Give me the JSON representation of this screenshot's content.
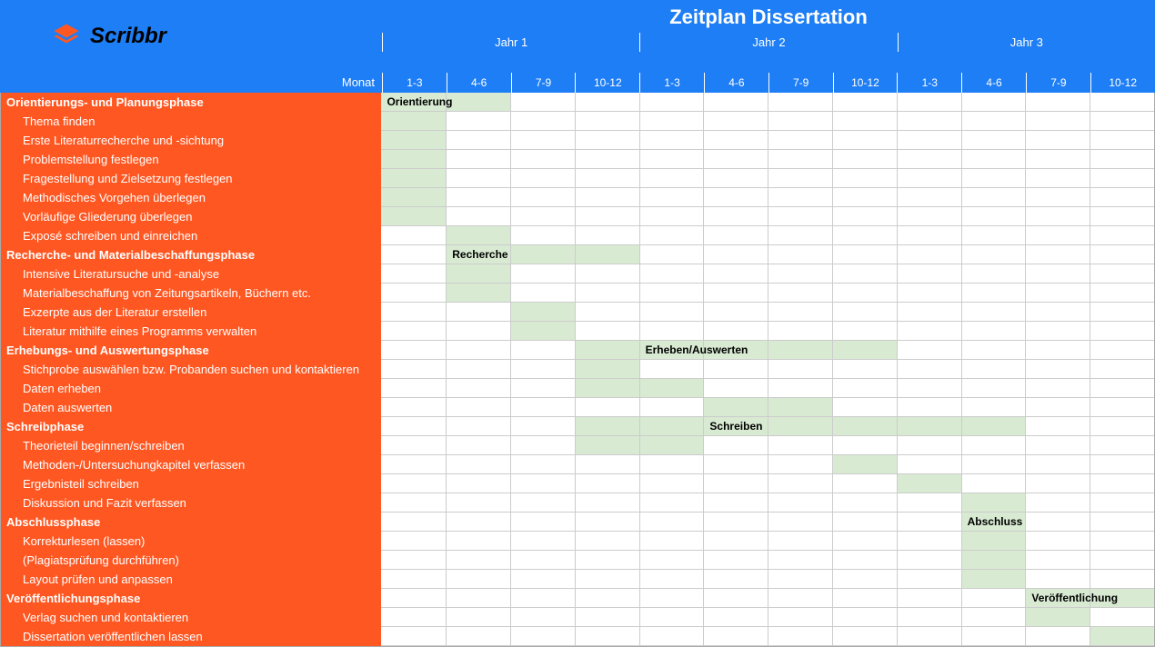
{
  "brand": "Scribbr",
  "title": "Zeitplan Dissertation",
  "month_label": "Monat",
  "years": [
    "Jahr 1",
    "Jahr 2",
    "Jahr 3"
  ],
  "months": [
    "1-3",
    "4-6",
    "7-9",
    "10-12",
    "1-3",
    "4-6",
    "7-9",
    "10-12",
    "1-3",
    "4-6",
    "7-9",
    "10-12"
  ],
  "phases": [
    {
      "name": "Orientierungs- und Planungsphase",
      "bar_label": "Orientierung",
      "label_col": 0,
      "cells": [
        0,
        1
      ],
      "tasks": [
        {
          "name": "Thema finden",
          "cells": [
            0
          ]
        },
        {
          "name": "Erste Literaturrecherche und -sichtung",
          "cells": [
            0
          ]
        },
        {
          "name": "Problemstellung festlegen",
          "cells": [
            0
          ]
        },
        {
          "name": "Fragestellung und Zielsetzung festlegen",
          "cells": [
            0
          ]
        },
        {
          "name": "Methodisches Vorgehen überlegen",
          "cells": [
            0
          ]
        },
        {
          "name": "Vorläufige Gliederung überlegen",
          "cells": [
            0
          ]
        },
        {
          "name": "Exposé schreiben und einreichen",
          "cells": [
            1
          ]
        }
      ]
    },
    {
      "name": "Recherche- und Materialbeschaffungsphase",
      "bar_label": "Recherche",
      "label_col": 1,
      "cells": [
        1,
        2,
        3
      ],
      "tasks": [
        {
          "name": "Intensive Literatursuche und -analyse",
          "cells": [
            1
          ]
        },
        {
          "name": "Materialbeschaffung von Zeitungsartikeln, Büchern etc.",
          "cells": [
            1
          ]
        },
        {
          "name": "Exzerpte aus der Literatur erstellen",
          "cells": [
            2
          ]
        },
        {
          "name": "Literatur mithilfe eines Programms verwalten",
          "cells": [
            2
          ]
        }
      ]
    },
    {
      "name": "Erhebungs- und Auswertungsphase",
      "bar_label": "Erheben/Auswerten",
      "label_col": 4,
      "cells": [
        3,
        4,
        5,
        6,
        7
      ],
      "tasks": [
        {
          "name": "Stichprobe auswählen bzw. Probanden suchen und kontaktieren",
          "cells": [
            3
          ]
        },
        {
          "name": "Daten erheben",
          "cells": [
            3,
            4
          ]
        },
        {
          "name": "Daten auswerten",
          "cells": [
            5,
            6
          ]
        }
      ]
    },
    {
      "name": "Schreibphase",
      "bar_label": "Schreiben",
      "label_col": 5,
      "cells": [
        3,
        4,
        5,
        6,
        7,
        8,
        9
      ],
      "tasks": [
        {
          "name": "Theorieteil beginnen/schreiben",
          "cells": [
            3,
            4
          ]
        },
        {
          "name": "Methoden-/Untersuchungkapitel verfassen",
          "cells": [
            7
          ]
        },
        {
          "name": "Ergebnisteil schreiben",
          "cells": [
            8
          ]
        },
        {
          "name": "Diskussion und Fazit verfassen",
          "cells": [
            9
          ]
        }
      ]
    },
    {
      "name": "Abschlussphase",
      "bar_label": "Abschluss",
      "label_col": 9,
      "cells": [
        9
      ],
      "tasks": [
        {
          "name": "Korrekturlesen (lassen)",
          "cells": [
            9
          ]
        },
        {
          "name": "(Plagiatsprüfung durchführen)",
          "cells": [
            9
          ]
        },
        {
          "name": "Layout prüfen und anpassen",
          "cells": [
            9
          ]
        }
      ]
    },
    {
      "name": "Veröffentlichungsphase",
      "bar_label": "Veröffentlichung",
      "label_col": 10,
      "cells": [
        10,
        11
      ],
      "tasks": [
        {
          "name": "Verlag suchen und kontaktieren",
          "cells": [
            10
          ]
        },
        {
          "name": "Dissertation veröffentlichen lassen",
          "cells": [
            11
          ]
        }
      ]
    }
  ],
  "chart_data": {
    "type": "gantt",
    "title": "Zeitplan Dissertation",
    "xlabel": "Monat",
    "time_axis": {
      "years": [
        "Jahr 1",
        "Jahr 2",
        "Jahr 3"
      ],
      "quarters_per_year": [
        "1-3",
        "4-6",
        "7-9",
        "10-12"
      ],
      "total_columns": 12
    },
    "rows": [
      {
        "label": "Orientierungs- und Planungsphase",
        "type": "phase",
        "bar_label": "Orientierung",
        "start": 0,
        "end": 1
      },
      {
        "label": "Thema finden",
        "type": "task",
        "start": 0,
        "end": 0
      },
      {
        "label": "Erste Literaturrecherche und -sichtung",
        "type": "task",
        "start": 0,
        "end": 0
      },
      {
        "label": "Problemstellung festlegen",
        "type": "task",
        "start": 0,
        "end": 0
      },
      {
        "label": "Fragestellung und Zielsetzung festlegen",
        "type": "task",
        "start": 0,
        "end": 0
      },
      {
        "label": "Methodisches Vorgehen überlegen",
        "type": "task",
        "start": 0,
        "end": 0
      },
      {
        "label": "Vorläufige Gliederung überlegen",
        "type": "task",
        "start": 0,
        "end": 0
      },
      {
        "label": "Exposé schreiben und einreichen",
        "type": "task",
        "start": 1,
        "end": 1
      },
      {
        "label": "Recherche- und Materialbeschaffungsphase",
        "type": "phase",
        "bar_label": "Recherche",
        "start": 1,
        "end": 3
      },
      {
        "label": "Intensive Literatursuche und -analyse",
        "type": "task",
        "start": 1,
        "end": 1
      },
      {
        "label": "Materialbeschaffung von Zeitungsartikeln, Büchern etc.",
        "type": "task",
        "start": 1,
        "end": 1
      },
      {
        "label": "Exzerpte aus der Literatur erstellen",
        "type": "task",
        "start": 2,
        "end": 2
      },
      {
        "label": "Literatur mithilfe eines Programms verwalten",
        "type": "task",
        "start": 2,
        "end": 2
      },
      {
        "label": "Erhebungs- und Auswertungsphase",
        "type": "phase",
        "bar_label": "Erheben/Auswerten",
        "start": 3,
        "end": 7
      },
      {
        "label": "Stichprobe auswählen bzw. Probanden suchen und kontaktieren",
        "type": "task",
        "start": 3,
        "end": 3
      },
      {
        "label": "Daten erheben",
        "type": "task",
        "start": 3,
        "end": 4
      },
      {
        "label": "Daten auswerten",
        "type": "task",
        "start": 5,
        "end": 6
      },
      {
        "label": "Schreibphase",
        "type": "phase",
        "bar_label": "Schreiben",
        "start": 3,
        "end": 9
      },
      {
        "label": "Theorieteil beginnen/schreiben",
        "type": "task",
        "start": 3,
        "end": 4
      },
      {
        "label": "Methoden-/Untersuchungkapitel verfassen",
        "type": "task",
        "start": 7,
        "end": 7
      },
      {
        "label": "Ergebnisteil schreiben",
        "type": "task",
        "start": 8,
        "end": 8
      },
      {
        "label": "Diskussion und Fazit verfassen",
        "type": "task",
        "start": 9,
        "end": 9
      },
      {
        "label": "Abschlussphase",
        "type": "phase",
        "bar_label": "Abschluss",
        "start": 9,
        "end": 9
      },
      {
        "label": "Korrekturlesen (lassen)",
        "type": "task",
        "start": 9,
        "end": 9
      },
      {
        "label": "(Plagiatsprüfung durchführen)",
        "type": "task",
        "start": 9,
        "end": 9
      },
      {
        "label": "Layout prüfen und anpassen",
        "type": "task",
        "start": 9,
        "end": 9
      },
      {
        "label": "Veröffentlichungsphase",
        "type": "phase",
        "bar_label": "Veröffentlichung",
        "start": 10,
        "end": 11
      },
      {
        "label": "Verlag suchen und kontaktieren",
        "type": "task",
        "start": 10,
        "end": 10
      },
      {
        "label": "Dissertation veröffentlichen lassen",
        "type": "task",
        "start": 11,
        "end": 11
      }
    ]
  }
}
